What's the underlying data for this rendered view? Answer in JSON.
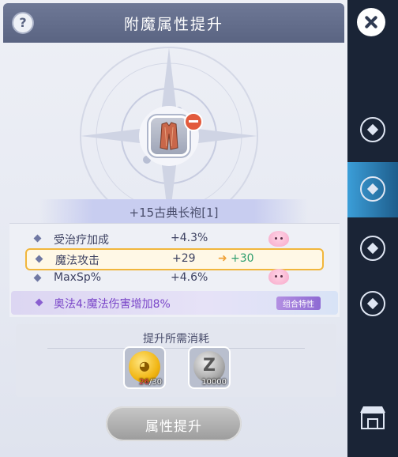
{
  "header": {
    "title": "附魔属性提升",
    "help_icon": "question-icon"
  },
  "item": {
    "name": "+15古典长袍[1]",
    "icon": "robe-icon"
  },
  "attributes": [
    {
      "name": "受治疗加成",
      "value": "+4.3%",
      "new_value": "",
      "pet": true
    },
    {
      "name": "魔法攻击",
      "value": "+29",
      "new_value": "+30",
      "pet": false,
      "highlighted": true
    },
    {
      "name": "MaxSp%",
      "value": "+4.6%",
      "new_value": "",
      "pet": true
    }
  ],
  "combo": {
    "text": "奥法4:魔法伤害增加8%",
    "tag": "组合特性"
  },
  "cost": {
    "title": "提升所需消耗",
    "items": [
      {
        "icon": "gold-coin-icon",
        "have": "26",
        "need": "/30"
      },
      {
        "icon": "zeny-coin-icon",
        "amount": "10000"
      }
    ]
  },
  "button": {
    "label": "属性提升"
  },
  "colors": {
    "accent": "#f1b63c",
    "new_value": "#2f9e6e",
    "combo": "#7a46c8",
    "side_active": "#3b9ed8"
  }
}
